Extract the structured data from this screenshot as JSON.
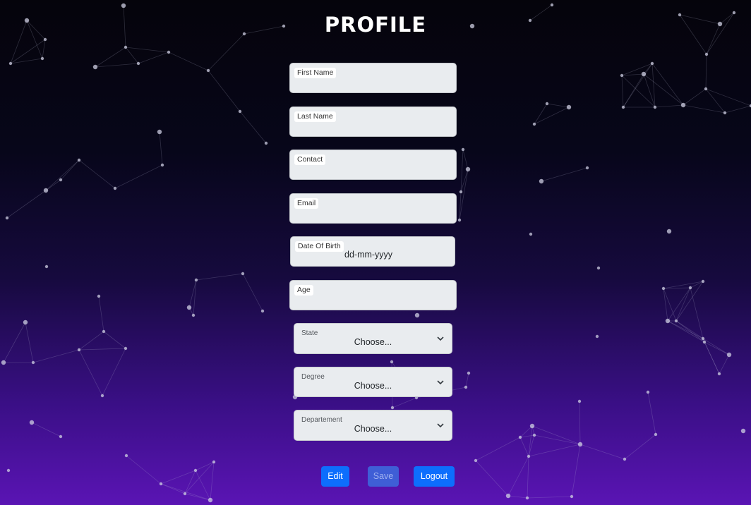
{
  "page": {
    "title": "PROFILE"
  },
  "fields": [
    {
      "label": "First Name",
      "value": ""
    },
    {
      "label": "Last Name",
      "value": ""
    },
    {
      "label": "Contact",
      "value": ""
    },
    {
      "label": "Email",
      "value": ""
    },
    {
      "label": "Date Of Birth",
      "value": "dd-mm-yyyy"
    },
    {
      "label": "Age",
      "value": ""
    }
  ],
  "selects": [
    {
      "label": "State",
      "value": "Choose..."
    },
    {
      "label": "Degree",
      "value": "Choose..."
    },
    {
      "label": "Departement",
      "value": "Choose..."
    }
  ],
  "buttons": {
    "edit": "Edit",
    "save": "Save",
    "logout": "Logout"
  },
  "colors": {
    "primary": "#0d6efd",
    "field_bg": "#e9ecef"
  }
}
